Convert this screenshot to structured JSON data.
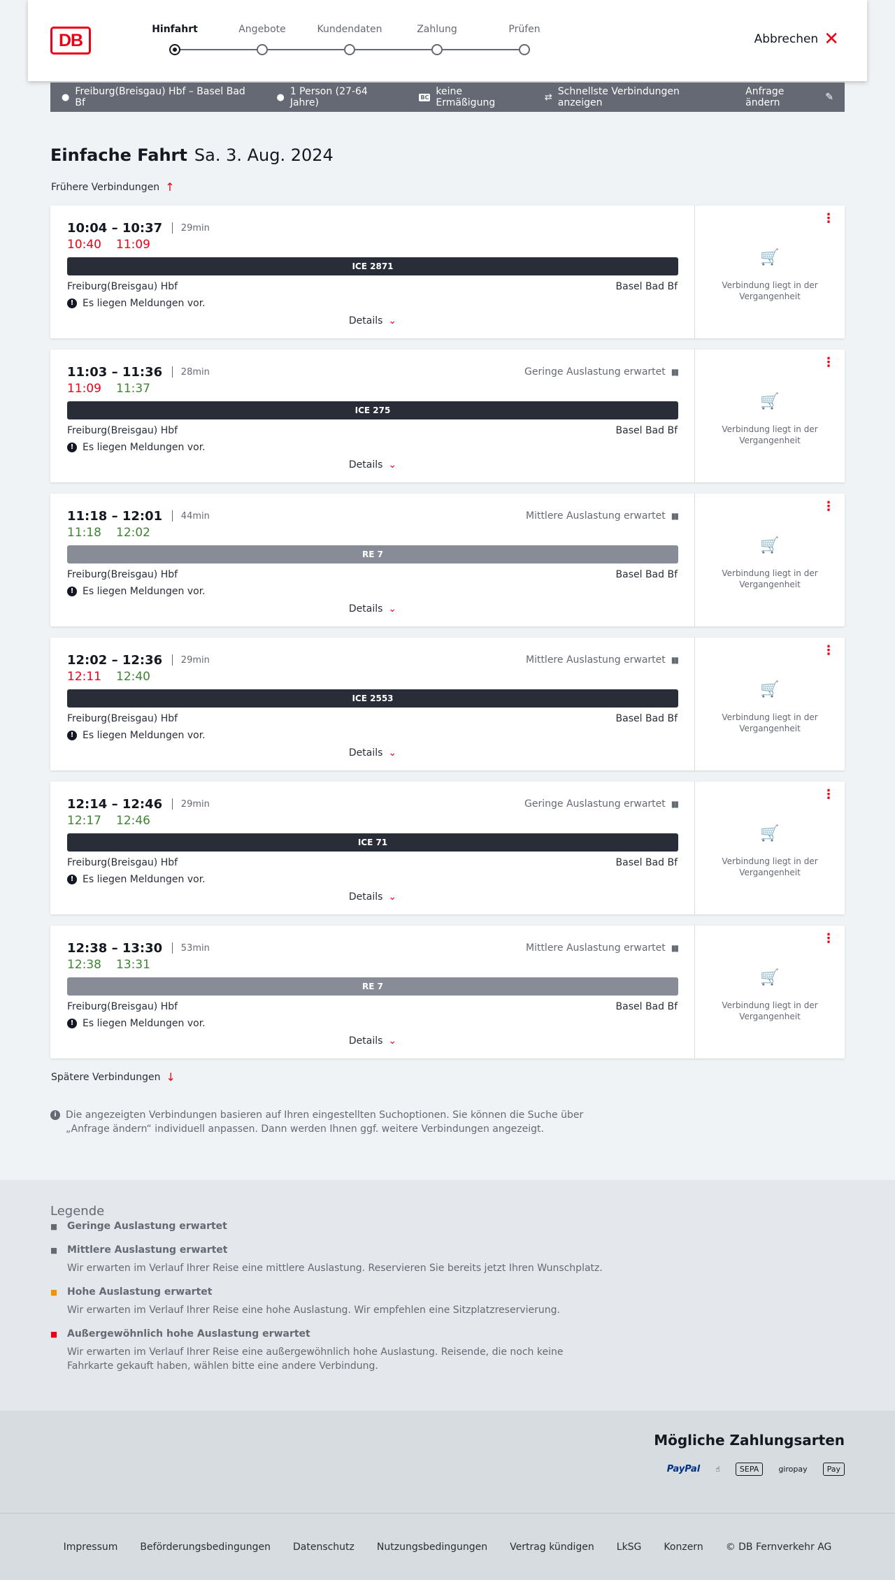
{
  "header": {
    "logo": "DB",
    "steps": [
      "Hinfahrt",
      "Angebote",
      "Kundendaten",
      "Zahlung",
      "Prüfen"
    ],
    "cancel_label": "Abbrechen"
  },
  "summary": {
    "route": "Freiburg(Breisgau) Hbf – Basel Bad Bf",
    "persons": "1 Person (27-64 Jahre)",
    "discount_badge": "BC",
    "discount": "keine Ermäßigung",
    "fastest": "Schnellste Verbindungen anzeigen",
    "edit_label": "Anfrage ändern"
  },
  "page": {
    "title": "Einfache Fahrt",
    "date": "Sa. 3. Aug. 2024",
    "earlier_label": "Frühere Verbindungen",
    "later_label": "Spätere Verbindungen",
    "info_text": "Die angezeigten Verbindungen basieren auf Ihren eingestellten Suchoptionen. Sie können die Suche über „Anfrage ändern“ individuell anpassen. Dann werden Ihnen ggf. weitere Verbindungen angezeigt."
  },
  "connections": [
    {
      "times": "10:04 – 10:37",
      "duration": "29min",
      "rt_dep": "10:40",
      "rt_dep_status": "red",
      "rt_arr": "11:09",
      "rt_arr_status": "red",
      "occupancy": "",
      "train": "ICE 2871",
      "train_type": "ice",
      "from": "Freiburg(Breisgau) Hbf",
      "to": "Basel Bad Bf",
      "message": "Es liegen Meldungen vor.",
      "details_label": "Details",
      "status": "Verbindung liegt in der Vergangenheit"
    },
    {
      "times": "11:03 – 11:36",
      "duration": "28min",
      "rt_dep": "11:09",
      "rt_dep_status": "red",
      "rt_arr": "11:37",
      "rt_arr_status": "green",
      "occupancy": "Geringe Auslastung erwartet",
      "train": "ICE 275",
      "train_type": "ice",
      "from": "Freiburg(Breisgau) Hbf",
      "to": "Basel Bad Bf",
      "message": "Es liegen Meldungen vor.",
      "details_label": "Details",
      "status": "Verbindung liegt in der Vergangenheit"
    },
    {
      "times": "11:18 – 12:01",
      "duration": "44min",
      "rt_dep": "11:18",
      "rt_dep_status": "green",
      "rt_arr": "12:02",
      "rt_arr_status": "green",
      "occupancy": "Mittlere Auslastung erwartet",
      "train": "RE 7",
      "train_type": "re",
      "from": "Freiburg(Breisgau) Hbf",
      "to": "Basel Bad Bf",
      "message": "Es liegen Meldungen vor.",
      "details_label": "Details",
      "status": "Verbindung liegt in der Vergangenheit"
    },
    {
      "times": "12:02 – 12:36",
      "duration": "29min",
      "rt_dep": "12:11",
      "rt_dep_status": "red",
      "rt_arr": "12:40",
      "rt_arr_status": "green",
      "occupancy": "Mittlere Auslastung erwartet",
      "train": "ICE 2553",
      "train_type": "ice",
      "from": "Freiburg(Breisgau) Hbf",
      "to": "Basel Bad Bf",
      "message": "Es liegen Meldungen vor.",
      "details_label": "Details",
      "status": "Verbindung liegt in der Vergangenheit"
    },
    {
      "times": "12:14 – 12:46",
      "duration": "29min",
      "rt_dep": "12:17",
      "rt_dep_status": "green",
      "rt_arr": "12:46",
      "rt_arr_status": "green",
      "occupancy": "Geringe Auslastung erwartet",
      "train": "ICE 71",
      "train_type": "ice",
      "from": "Freiburg(Breisgau) Hbf",
      "to": "Basel Bad Bf",
      "message": "Es liegen Meldungen vor.",
      "details_label": "Details",
      "status": "Verbindung liegt in der Vergangenheit"
    },
    {
      "times": "12:38 – 13:30",
      "duration": "53min",
      "rt_dep": "12:38",
      "rt_dep_status": "green",
      "rt_arr": "13:31",
      "rt_arr_status": "green",
      "occupancy": "Mittlere Auslastung erwartet",
      "train": "RE 7",
      "train_type": "re",
      "from": "Freiburg(Breisgau) Hbf",
      "to": "Basel Bad Bf",
      "message": "Es liegen Meldungen vor.",
      "details_label": "Details",
      "status": "Verbindung liegt in der Vergangenheit"
    }
  ],
  "legend": {
    "title": "Legende",
    "items": [
      {
        "title": "Geringe Auslastung erwartet",
        "desc": "",
        "color": "#646973"
      },
      {
        "title": "Mittlere Auslastung erwartet",
        "desc": "Wir erwarten im Verlauf Ihrer Reise eine mittlere Auslastung. Reservieren Sie bereits jetzt Ihren Wunschplatz.",
        "color": "#646973"
      },
      {
        "title": "Hohe Auslastung erwartet",
        "desc": "Wir erwarten im Verlauf Ihrer Reise eine hohe Auslastung. Wir empfehlen eine Sitzplatzreservierung.",
        "color": "#f39200"
      },
      {
        "title": "Außergewöhnlich hohe Auslastung erwartet",
        "desc": "Wir erwarten im Verlauf Ihrer Reise eine außergewöhnlich hohe Auslastung. Reisende, die noch keine Fahrkarte gekauft haben, wählen bitte eine andere Verbindung.",
        "color": "#ec0016"
      }
    ]
  },
  "payment": {
    "title": "Mögliche Zahlungsarten",
    "methods": [
      "PayPal",
      "SEPA",
      "giropay",
      "Pay"
    ]
  },
  "footer": {
    "links": [
      "Impressum",
      "Beförderungsbedingungen",
      "Datenschutz",
      "Nutzungsbedingungen",
      "Vertrag kündigen",
      "LkSG",
      "Konzern",
      "© DB Fernverkehr AG"
    ]
  },
  "colors": {
    "accent": "#ec0016",
    "on_time": "#408335",
    "dark": "#282d37",
    "summary_bar": "#646973"
  }
}
